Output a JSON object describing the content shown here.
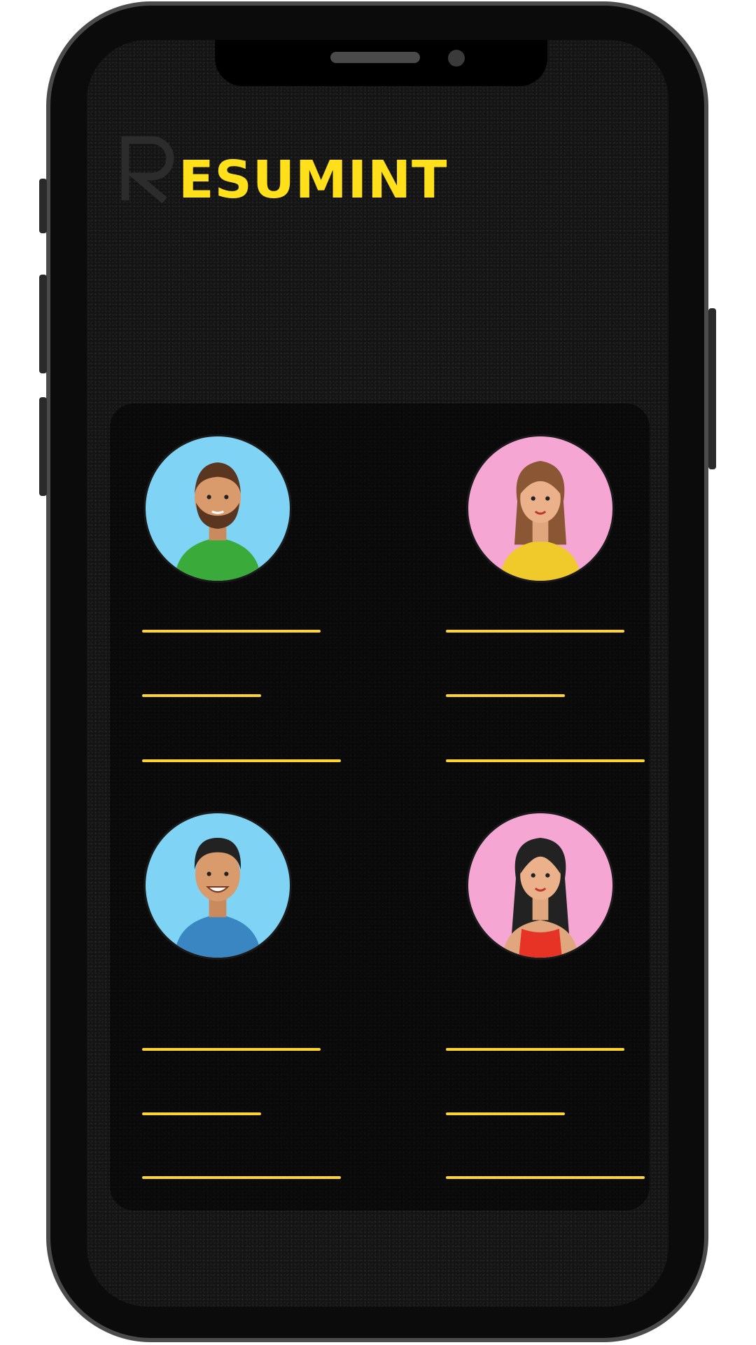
{
  "app": {
    "logo_mark": "R",
    "logo_text": "ESUMINT",
    "accent_color": "#ffe01b"
  },
  "profiles": [
    {
      "avatar_icon": "man-beard-avatar-icon",
      "background": "#7fd4f5",
      "shirt": "#3aaa3a",
      "gender": "male"
    },
    {
      "avatar_icon": "woman-avatar-icon",
      "background": "#f6a6d2",
      "shirt": "#f0c92a",
      "gender": "female"
    },
    {
      "avatar_icon": "man-smile-avatar-icon",
      "background": "#7fd4f5",
      "shirt": "#3a86c2",
      "gender": "male"
    },
    {
      "avatar_icon": "woman-longhair-avatar-icon",
      "background": "#f6a6d2",
      "shirt": "#e63325",
      "gender": "female"
    }
  ]
}
